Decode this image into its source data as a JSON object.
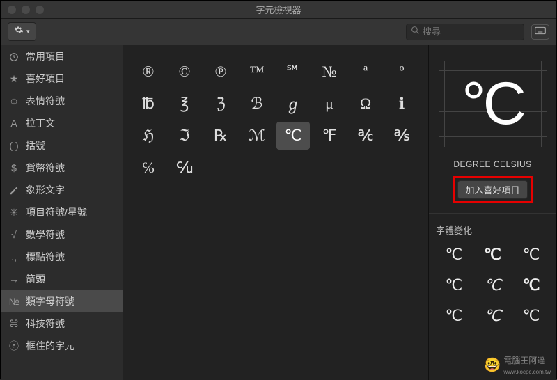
{
  "window_title": "字元檢視器",
  "search": {
    "placeholder": "搜尋"
  },
  "sidebar": {
    "items": [
      {
        "icon": "clock",
        "label": "常用項目"
      },
      {
        "icon": "star",
        "label": "喜好項目"
      },
      {
        "icon": "smile",
        "label": "表情符號"
      },
      {
        "icon": "A",
        "label": "拉丁文"
      },
      {
        "icon": "( )",
        "label": "括號"
      },
      {
        "icon": "$",
        "label": "貨幣符號"
      },
      {
        "icon": "draw",
        "label": "象形文字"
      },
      {
        "icon": "✳",
        "label": "項目符號/星號"
      },
      {
        "icon": "√",
        "label": "數學符號"
      },
      {
        "icon": "․,",
        "label": "標點符號"
      },
      {
        "icon": "→",
        "label": "箭頭"
      },
      {
        "icon": "№",
        "label": "類字母符號"
      },
      {
        "icon": "⌘",
        "label": "科技符號"
      },
      {
        "icon": "ⓐ",
        "label": "框住的字元"
      }
    ],
    "selected_index": 11
  },
  "characters": [
    "®",
    "©",
    "℗",
    "™",
    "℠",
    "№",
    "ª",
    "º",
    "℔",
    "℥",
    "ℨ",
    "ℬ",
    "ℊ",
    "μ",
    "Ω",
    "ℹ",
    "ℌ",
    "ℑ",
    "℞",
    "ℳ",
    "℃",
    "℉",
    "℀",
    "℁",
    "℅",
    "℆"
  ],
  "selected_char_index": 20,
  "detail": {
    "preview": "°C",
    "name": "DEGREE CELSIUS",
    "add_fav_label": "加入喜好項目",
    "variants_label": "字體變化",
    "variants": [
      "℃",
      "℃",
      "℃",
      "℃",
      "℃",
      "℃",
      "℃",
      "℃",
      "℃"
    ]
  },
  "watermark": "電腦王阿達",
  "watermark_url": "www.kocpc.com.tw"
}
